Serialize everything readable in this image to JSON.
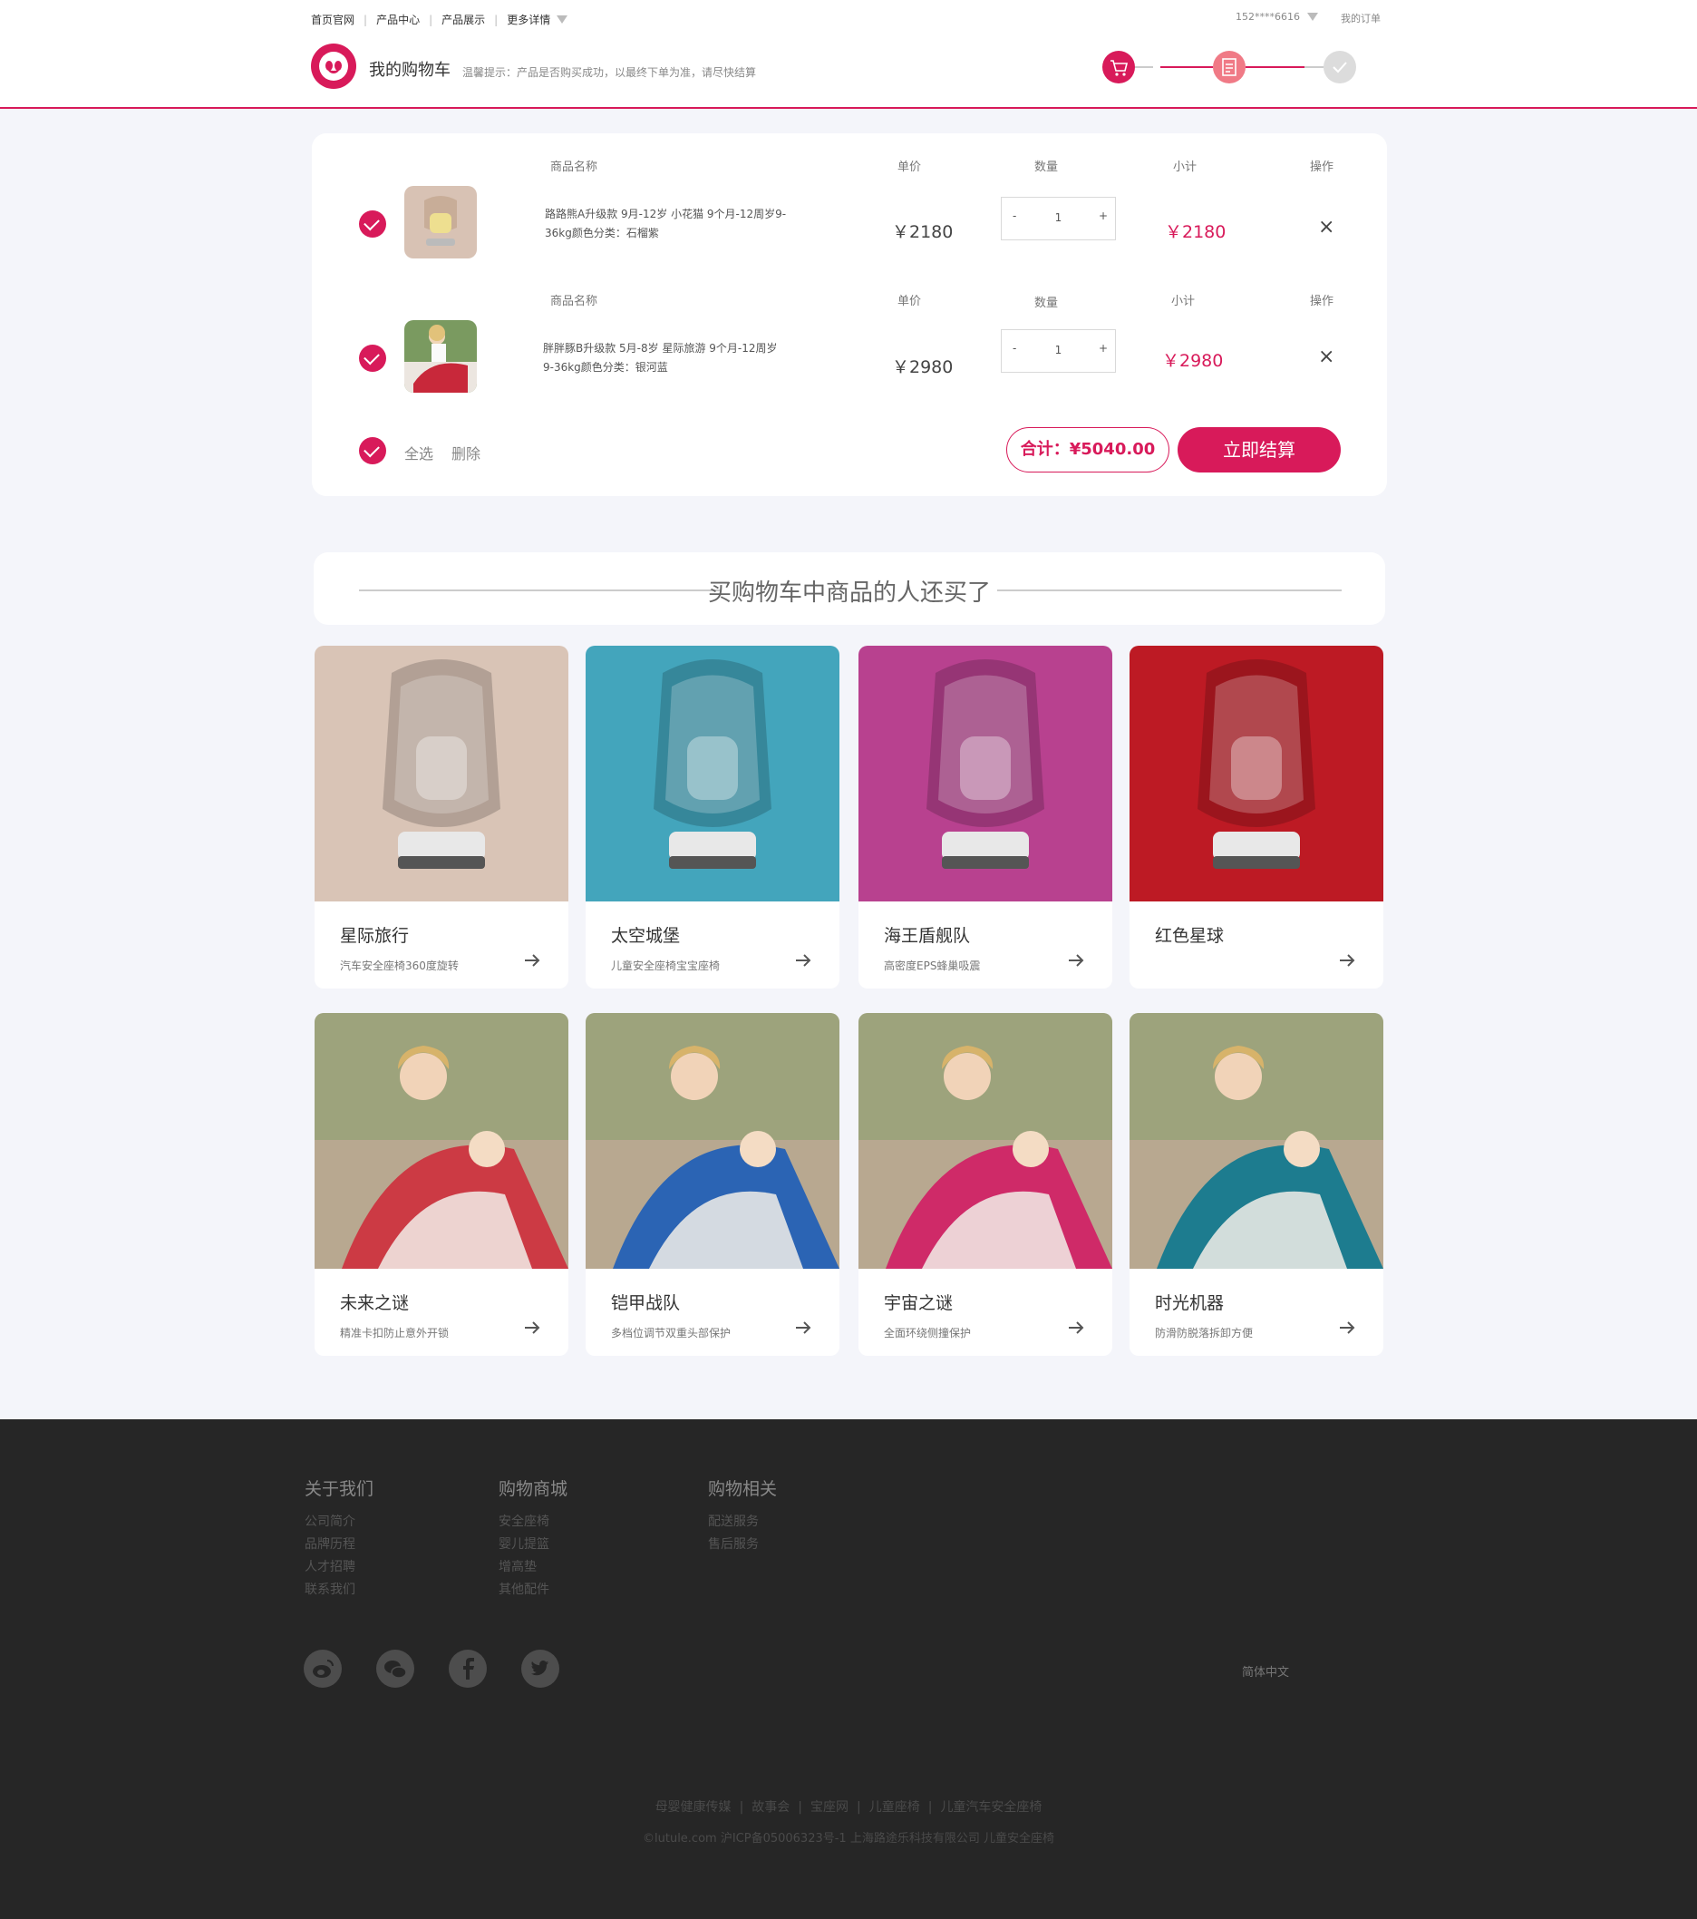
{
  "nav": {
    "links": [
      "首页官网",
      "产品中心",
      "产品展示",
      "更多详情"
    ],
    "account": "152****6616",
    "my_orders": "我的订单"
  },
  "header": {
    "title": "我的购物车",
    "tip": "温馨提示：产品是否购买成功，以最终下单为准，请尽快结算"
  },
  "steps": [
    "cart-icon",
    "order-icon",
    "check-icon"
  ],
  "cart": {
    "columns": {
      "name": "商品名称",
      "price": "单价",
      "qty": "数量",
      "subtotal": "小计",
      "action": "操作"
    },
    "items": [
      {
        "name": "路路熊A升级款 9月-12岁 小花猫 9个月-12周岁9-36kg颜色分类：石榴紫",
        "price": "￥2180",
        "qty": "1",
        "subtotal": "￥2180",
        "checked": true
      },
      {
        "name": "胖胖豚B升级款 5月-8岁 星际旅游 9个月-12周岁9-36kg颜色分类：银河蓝",
        "price": "￥2980",
        "qty": "1",
        "subtotal": "￥2980",
        "checked": true
      }
    ],
    "minus": "-",
    "plus": "+",
    "remove": "×",
    "select_all": "全选",
    "delete": "删除",
    "total": "合计：¥5040.00",
    "checkout": "立即结算"
  },
  "recommend": {
    "title": "买购物车中商品的人还买了",
    "products": [
      {
        "name": "星际旅行",
        "desc": "汽车安全座椅360度旋转",
        "color": "#d9c4b6"
      },
      {
        "name": "太空城堡",
        "desc": "儿童安全座椅宝宝座椅",
        "color": "#43a5bc"
      },
      {
        "name": "海王盾舰队",
        "desc": "高密度EPS蜂巢吸震",
        "color": "#b8418f"
      },
      {
        "name": "红色星球",
        "desc": "",
        "color": "#bd1a24"
      },
      {
        "name": "未来之谜",
        "desc": "精准卡扣防止意外开锁",
        "color": "#cc3a44"
      },
      {
        "name": "铠甲战队",
        "desc": "多档位调节双重头部保护",
        "color": "#2b64b4"
      },
      {
        "name": "宇宙之谜",
        "desc": "全面环绕侧撞保护",
        "color": "#cf2a68"
      },
      {
        "name": "时光机器",
        "desc": "防滑防脱落拆卸方便",
        "color": "#1d7c8f"
      }
    ]
  },
  "footer": {
    "columns": [
      {
        "title": "关于我们",
        "links": [
          "公司简介",
          "品牌历程",
          "人才招聘",
          "联系我们"
        ]
      },
      {
        "title": "购物商城",
        "links": [
          "安全座椅",
          "婴儿提篮",
          "增高垫",
          "其他配件"
        ]
      },
      {
        "title": "购物相关",
        "links": [
          "",
          "配送服务",
          "售后服务"
        ]
      }
    ],
    "social": [
      "weibo-icon",
      "wechat-icon",
      "facebook-icon",
      "twitter-icon"
    ],
    "language": "简体中文",
    "links": [
      "母婴健康传媒",
      "故事会",
      "宝座网",
      "儿童座椅",
      "儿童汽车安全座椅"
    ],
    "copyright": "©lutule.com 沪ICP备05006323号-1 上海路途乐科技有限公司 儿童安全座椅"
  }
}
